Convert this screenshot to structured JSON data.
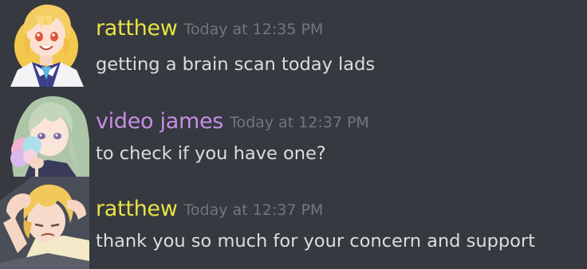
{
  "messages": [
    {
      "author": "ratthew",
      "author_color": "#e8e245",
      "timestamp": "Today at 12:35 PM",
      "text": "getting a brain scan today lads",
      "avatar": "blonde-anime-avatar"
    },
    {
      "author": "video james",
      "author_color": "#c78ee6",
      "timestamp": "Today at 12:37 PM",
      "text": "to check if you have one?",
      "avatar": "green-haired-anime-avatar"
    },
    {
      "author": "ratthew",
      "author_color": "#e8e245",
      "timestamp": "Today at 12:37 PM",
      "text": "thank you so much for your concern and support",
      "avatar": "distressed-blonde-anime-avatar"
    }
  ],
  "colors": {
    "background": "#36393f",
    "timestamp": "#72767d",
    "message_text": "#dcddde"
  }
}
